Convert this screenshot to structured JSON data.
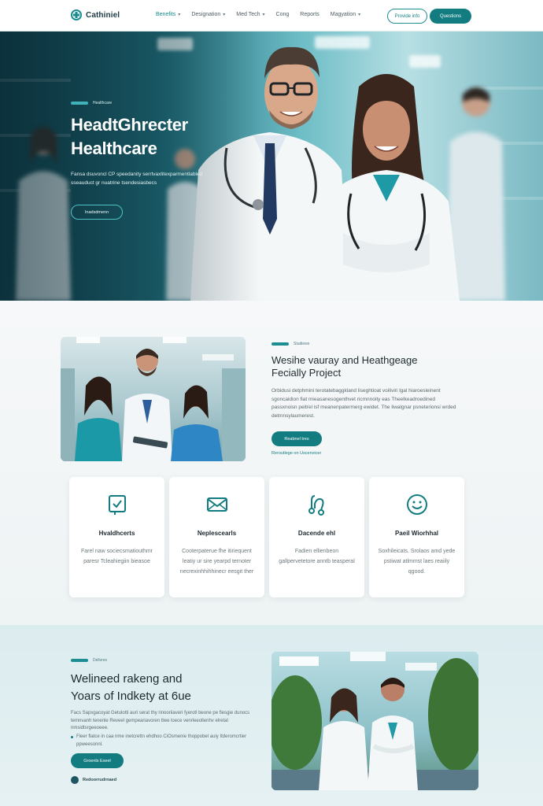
{
  "nav": {
    "logo_text": "Cathiniel",
    "items": [
      {
        "label": "Benefits",
        "caret": true,
        "active": true
      },
      {
        "label": "Designation",
        "caret": true,
        "active": false
      },
      {
        "label": "Med Tech",
        "caret": true,
        "active": false
      },
      {
        "label": "Cong",
        "caret": false,
        "active": false
      },
      {
        "label": "Reports",
        "caret": false,
        "active": false
      },
      {
        "label": "Magyation",
        "caret": true,
        "active": false
      }
    ],
    "outline_button": "Provide info",
    "solid_button": "Questions"
  },
  "hero": {
    "tag": "Healthcare",
    "title_line1": "HeadtGhrecter",
    "title_line2": "Healthcare",
    "description": "Fansa dsuvoncl CP speedanity serrtvaxlitexparmentlabled sseauduct gr nuatrine tsendesiasbecs",
    "button": "Inadsdmenn"
  },
  "feature": {
    "tag": "Studiews",
    "title": "Wesihe vauray and Heathgeage Fecially Project",
    "description": "Orbidusi detphmini terotatebaggkland liseghtioat voiliviri lgal hiaroesleinent sgoncaidion fiat mieasanesogenthvet ricmnnoity eas Theelkeadroedined passxnoisn peitrel isf meanenpatermerg ewidet. The liwalgnar psneterionsi wrded detmnsylaumerest.",
    "button": "Reabnel tres",
    "link": "Reroutlege on Uscenvicer"
  },
  "cards": [
    {
      "icon": "tablet-icon",
      "title": "Hvaldhcerts",
      "text": "Farel naw sociecsmatiouthmr paresr Tcleahiegiin bieasoe"
    },
    {
      "icon": "envelope-icon",
      "title": "Neplescearls",
      "text": "Cooterpaterue fhe itiriequent leatiy ur sire yearpd ternoter necrexinhhihhinecr eesgit ther"
    },
    {
      "icon": "stethoscope-icon",
      "title": "Dacende ehl",
      "text": "Fadien ellienbeon gallpervetetore anntb teasperal"
    },
    {
      "icon": "smile-icon",
      "title": "Paeil Wiorhhal",
      "text": "Soxhileicats. Srolaos amd yede pstiwat atlmmst laes reaiily qgood."
    }
  ],
  "section3": {
    "tag": "Delivres",
    "title_line1": "Welineed rakeng and",
    "title_line2": "Yoars of Indkety at 6ue",
    "description": "Facs Sapxgacoyat Getulotti auri serat thy rinooriiaveri fyerotl beone pe flesgie dunocs temnvanh tenenle Reveel gempeariavoren tlwe loece venrleeollenhv elretal nmsidtsrgeeoeee.",
    "bullet": "Fleer flatce in caa nme inetcrettn ehdhoo CiOsmenie thoppobel auiy Itderomcrtier ppweesonnl.",
    "button": "Groenls Exeel",
    "footer": "Redoorrudrnaed"
  }
}
